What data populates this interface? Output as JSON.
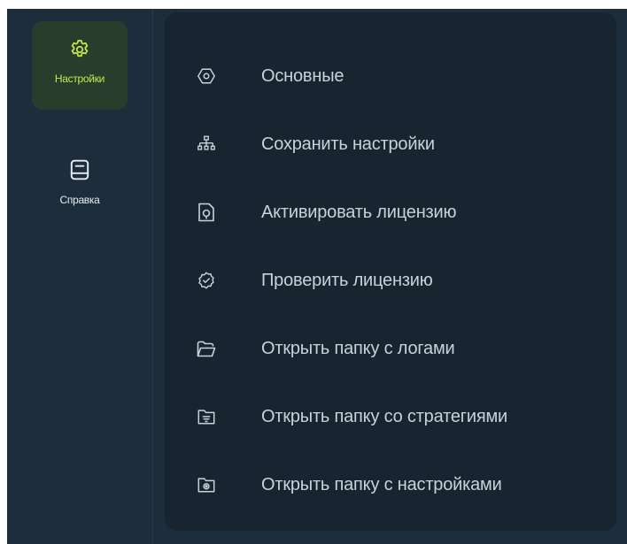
{
  "colors": {
    "accent": "#c6ea4a",
    "sidebar_bg": "#1e2d3b",
    "panel_bg": "#182430",
    "active_bg": "#293d2d",
    "text": "#c9d2d9"
  },
  "sidebar": {
    "items": [
      {
        "label": "Настройки",
        "icon": "gear-icon",
        "active": true
      },
      {
        "label": "Справка",
        "icon": "book-icon",
        "active": false
      }
    ]
  },
  "menu": {
    "items": [
      {
        "label": "Основные",
        "icon": "hexagon-icon"
      },
      {
        "label": "Сохранить настройки",
        "icon": "hierarchy-icon"
      },
      {
        "label": "Активировать лицензию",
        "icon": "license-file-icon"
      },
      {
        "label": "Проверить лицензию",
        "icon": "verified-badge-icon"
      },
      {
        "label": "Открыть папку с логами",
        "icon": "folder-open-icon"
      },
      {
        "label": "Открыть папку со стратегиями",
        "icon": "folder-strategy-icon"
      },
      {
        "label": "Открыть папку с настройками",
        "icon": "folder-settings-icon"
      }
    ]
  }
}
